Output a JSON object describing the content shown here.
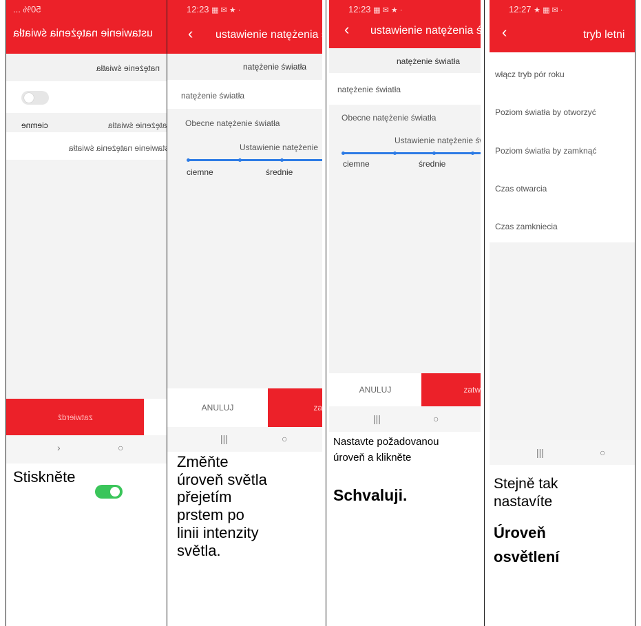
{
  "panel1": {
    "status_text": "50% ...",
    "header_title": "ustawienie natężenia światła",
    "section_title": "natężenie światła",
    "row_label": "natężenie światła",
    "row_value": "ciemne",
    "slider_title": "Ustawienie natężenia światła",
    "confirm_label": "zatwierdź",
    "caption": "Stiskněte"
  },
  "panel2": {
    "status_time": "12:23",
    "header_title": "ustawienie natężenia ś",
    "section_title": "natężenie światła",
    "row_label": "natężenie światła",
    "current_label": "Obecne natężenie światła",
    "slider_title": "Ustawienie natężenie",
    "level_dark": "ciemne",
    "level_medium": "średnie",
    "cancel_label": "ANULUJ",
    "confirm_label": "za",
    "caption_lines": [
      "Změňte",
      "úroveň světla",
      "přejetím",
      "prstem po",
      "linii intenzity",
      "světla."
    ]
  },
  "panel3": {
    "status_time": "12:23",
    "header_title": "ustawienie natężenia św",
    "section_title": "natężenie światła",
    "row_label": "natężenie światła",
    "current_label": "Obecne natężenie światła",
    "slider_title": "Ustawienie natężenie św",
    "level_dark": "ciemne",
    "level_medium": "średnie",
    "cancel_label": "ANULUJ",
    "confirm_label": "zatw",
    "caption_small_1": "Nastavte požadovanou",
    "caption_small_2": "úroveň a klikněte",
    "caption_bold": "Schvaluji."
  },
  "panel4": {
    "status_time": "12:27",
    "header_title": "tryb letni",
    "items": [
      "włącz tryb pór roku",
      "Poziom światła by otworzyć",
      "Poziom światła by zamknąć",
      "Czas otwarcia",
      "Czas zamkniecia"
    ],
    "caption_1": "Stejně tak",
    "caption_2": "nastavíte",
    "caption_bold_1": "Úroveň",
    "caption_bold_2": "osvětlení"
  },
  "colors": {
    "accent_red": "#ec2129",
    "slider_blue": "#2d7be5",
    "toggle_green": "#3ac55a"
  }
}
